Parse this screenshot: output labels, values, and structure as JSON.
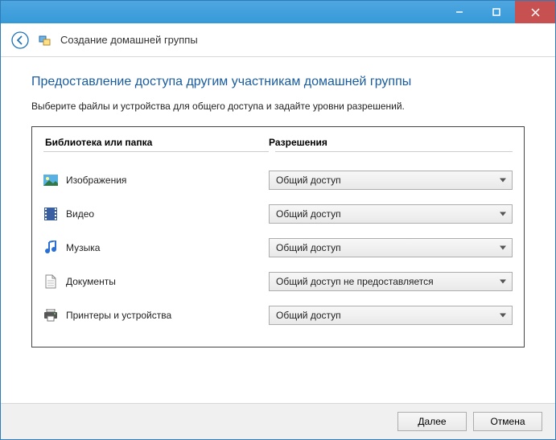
{
  "window": {
    "title": "Создание домашней группы"
  },
  "page": {
    "heading": "Предоставление доступа другим участникам домашней группы",
    "instruction": "Выберите файлы и устройства для общего доступа и задайте уровни разрешений."
  },
  "columns": {
    "library": "Библиотека или папка",
    "permissions": "Разрешения"
  },
  "items": [
    {
      "icon": "pictures-icon",
      "label": "Изображения",
      "permission": "Общий доступ"
    },
    {
      "icon": "video-icon",
      "label": "Видео",
      "permission": "Общий доступ"
    },
    {
      "icon": "music-icon",
      "label": "Музыка",
      "permission": "Общий доступ"
    },
    {
      "icon": "documents-icon",
      "label": "Документы",
      "permission": "Общий доступ не предоставляется"
    },
    {
      "icon": "printers-icon",
      "label": "Принтеры и устройства",
      "permission": "Общий доступ"
    }
  ],
  "buttons": {
    "next": "Далее",
    "cancel": "Отмена"
  }
}
